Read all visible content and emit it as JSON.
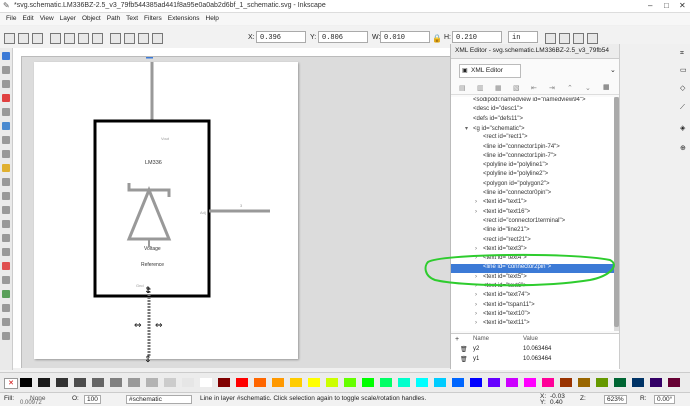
{
  "window": {
    "title": "*svg.schematic.LM336BZ-2.5_v3_79fb544385ad441f8a95e0a0ab2d6bf_1_schematic.svg - Inkscape"
  },
  "menu": [
    "File",
    "Edit",
    "View",
    "Layer",
    "Object",
    "Path",
    "Text",
    "Filters",
    "Extensions",
    "Help"
  ],
  "toolbar": {
    "x_label": "X:",
    "x_value": "0.396",
    "y_label": "Y:",
    "y_value": "0.806",
    "w_label": "W:",
    "w_value": "0.010",
    "h_label": "H:",
    "h_value": "0.210",
    "unit": "in"
  },
  "drawing": {
    "part": "LM336",
    "pin_top": "Vout",
    "pin_right": "Adj",
    "label1": "Voltage",
    "label2": "Reference",
    "pin_bottom": "Gnd",
    "pin_right_num": "3"
  },
  "xml_editor": {
    "tab_title": "XML Editor - svg.schematic.LM336BZ-2.5_v3_79fb54",
    "tab_label": "XML Editor",
    "nodes": [
      {
        "indent": 0,
        "twisty": "",
        "text": "<sodipodi:namedview id=\"namedview94\">"
      },
      {
        "indent": 0,
        "twisty": "",
        "text": "<desc id=\"desc1\">"
      },
      {
        "indent": 0,
        "twisty": "",
        "text": "<defs id=\"defs11\">"
      },
      {
        "indent": 0,
        "twisty": "▾",
        "text": "<g id=\"schematic\">"
      },
      {
        "indent": 1,
        "twisty": "",
        "text": "<rect id=\"rect1\">"
      },
      {
        "indent": 1,
        "twisty": "",
        "text": "<line id=\"connector1pin-74\">"
      },
      {
        "indent": 1,
        "twisty": "",
        "text": "<line id=\"connector1pin-7\">"
      },
      {
        "indent": 1,
        "twisty": "",
        "text": "<polyline id=\"polyline1\">"
      },
      {
        "indent": 1,
        "twisty": "",
        "text": "<polyline id=\"polyline2\">"
      },
      {
        "indent": 1,
        "twisty": "",
        "text": "<polygon id=\"polygon2\">"
      },
      {
        "indent": 1,
        "twisty": "",
        "text": "<line id=\"connector0pin\">"
      },
      {
        "indent": 1,
        "twisty": "›",
        "text": "<text id=\"text1\">"
      },
      {
        "indent": 1,
        "twisty": "›",
        "text": "<text id=\"text16\">"
      },
      {
        "indent": 1,
        "twisty": "",
        "text": "<rect id=\"connector1terminal\">"
      },
      {
        "indent": 1,
        "twisty": "",
        "text": "<line id=\"line21\">"
      },
      {
        "indent": 1,
        "twisty": "",
        "text": "<rect id=\"rect21\">"
      },
      {
        "indent": 1,
        "twisty": "›",
        "text": "<text id=\"text3\">"
      },
      {
        "indent": 1,
        "twisty": "›",
        "text": "<text id=\"text4\">"
      },
      {
        "indent": 1,
        "twisty": "",
        "text": "<line id=\"connector2pin\">",
        "selected": true
      },
      {
        "indent": 1,
        "twisty": "›",
        "text": "<text id=\"text5\">"
      },
      {
        "indent": 1,
        "twisty": "›",
        "text": "<text id=\"text6\">"
      },
      {
        "indent": 1,
        "twisty": "›",
        "text": "<text id=\"text74\">"
      },
      {
        "indent": 1,
        "twisty": "›",
        "text": "<text id=\"tspan11\">"
      },
      {
        "indent": 1,
        "twisty": "›",
        "text": "<text id=\"text10\">"
      },
      {
        "indent": 1,
        "twisty": "›",
        "text": "<text id=\"text11\">"
      }
    ],
    "attr_header": {
      "name": "Name",
      "value": "Value"
    },
    "attrs": [
      {
        "name": "y2",
        "value": "10.063464"
      },
      {
        "name": "y1",
        "value": "10.063464"
      }
    ]
  },
  "status": {
    "fill_label": "Fill:",
    "fill_value": "None",
    "stroke_value": "0.00972",
    "opacity_label": "O:",
    "opacity_value": "100",
    "layer": "#schematic",
    "message": "Line in layer #schematic. Click selection again to toggle scale/rotation handles.",
    "x_label": "X:",
    "x_val": "-0.03",
    "y_label": "Y:",
    "y_val": "0.40",
    "z_label": "Z:",
    "zoom": "623%",
    "r_label": "R:",
    "rot": "0.00°"
  },
  "colors": {
    "annotation": "#2ecc2e",
    "selection": "#3c7ad6",
    "drawing_gray": "#999999",
    "outline": "#000000"
  },
  "palette": [
    "#000000",
    "#1a1a1a",
    "#333333",
    "#4d4d4d",
    "#666666",
    "#808080",
    "#999999",
    "#b3b3b3",
    "#cccccc",
    "#e6e6e6",
    "#ffffff",
    "#800000",
    "#ff0000",
    "#ff6600",
    "#ff9900",
    "#ffcc00",
    "#ffff00",
    "#ccff00",
    "#66ff00",
    "#00ff00",
    "#00ff66",
    "#00ffcc",
    "#00ffff",
    "#00ccff",
    "#0066ff",
    "#0000ff",
    "#6600ff",
    "#cc00ff",
    "#ff00ff",
    "#ff0099",
    "#993300",
    "#996600",
    "#669900",
    "#006633",
    "#003366",
    "#330066",
    "#660033"
  ]
}
